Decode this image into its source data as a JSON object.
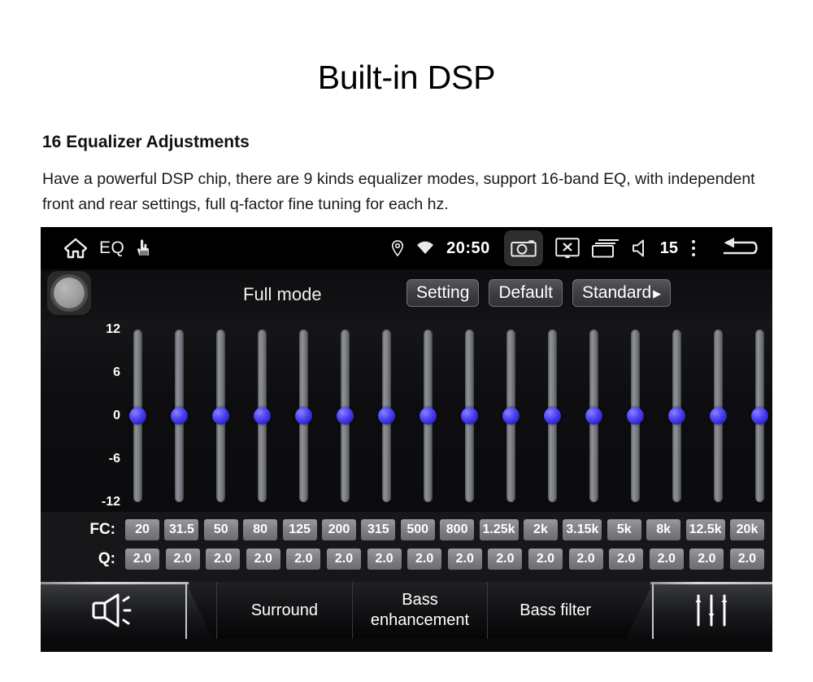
{
  "document": {
    "title": "Built-in DSP",
    "subtitle": "16 Equalizer Adjustments",
    "body": "Have a powerful DSP chip, there are 9 kinds equalizer modes, support 16-band EQ, with independent front and rear settings, full q-factor fine tuning for each hz."
  },
  "device": {
    "statusbar": {
      "home_icon": "home-icon",
      "app_label": "EQ",
      "touch_icon": "hand-touch-icon",
      "location_icon": "location-pin-icon",
      "wifi_icon": "wifi-icon",
      "time": "20:50",
      "camera_icon": "camera-icon",
      "screen_off_icon": "screen-off-icon",
      "recents_icon": "recent-apps-icon",
      "volume_icon": "speaker-icon",
      "volume_level": "15",
      "overflow_icon": "more-vertical-icon",
      "back_icon": "back-arrow-icon"
    },
    "mode_row": {
      "power_button_icon": "power-circle-icon",
      "mode_label": "Full mode",
      "buttons": [
        {
          "label": "Setting",
          "arrow": ""
        },
        {
          "label": "Default",
          "arrow": ""
        },
        {
          "label": "Standard",
          "arrow": "▶"
        }
      ]
    },
    "equalizer": {
      "fc_label": "FC:",
      "q_label": "Q:",
      "y_axis_labels": [
        "12",
        "6",
        "0",
        "-6",
        "-12"
      ],
      "thumb_color": "#3f33e8",
      "bands": [
        {
          "fc": "20",
          "q": "2.0",
          "gain": 0
        },
        {
          "fc": "31.5",
          "q": "2.0",
          "gain": 0
        },
        {
          "fc": "50",
          "q": "2.0",
          "gain": 0
        },
        {
          "fc": "80",
          "q": "2.0",
          "gain": 0
        },
        {
          "fc": "125",
          "q": "2.0",
          "gain": 0
        },
        {
          "fc": "200",
          "q": "2.0",
          "gain": 0
        },
        {
          "fc": "315",
          "q": "2.0",
          "gain": 0
        },
        {
          "fc": "500",
          "q": "2.0",
          "gain": 0
        },
        {
          "fc": "800",
          "q": "2.0",
          "gain": 0
        },
        {
          "fc": "1.25k",
          "q": "2.0",
          "gain": 0
        },
        {
          "fc": "2k",
          "q": "2.0",
          "gain": 0
        },
        {
          "fc": "3.15k",
          "q": "2.0",
          "gain": 0
        },
        {
          "fc": "5k",
          "q": "2.0",
          "gain": 0
        },
        {
          "fc": "8k",
          "q": "2.0",
          "gain": 0
        },
        {
          "fc": "12.5k",
          "q": "2.0",
          "gain": 0
        },
        {
          "fc": "20k",
          "q": "2.0",
          "gain": 0
        }
      ]
    },
    "tabs": [
      {
        "label": "",
        "icon": "speaker-sound-icon",
        "active": false
      },
      {
        "label": "Surround",
        "icon": "",
        "active": false
      },
      {
        "label": "Bass enhancement",
        "icon": "",
        "active": false
      },
      {
        "label": "Bass filter",
        "icon": "",
        "active": false
      },
      {
        "label": "",
        "icon": "equalizer-sliders-icon",
        "active": true
      }
    ]
  }
}
